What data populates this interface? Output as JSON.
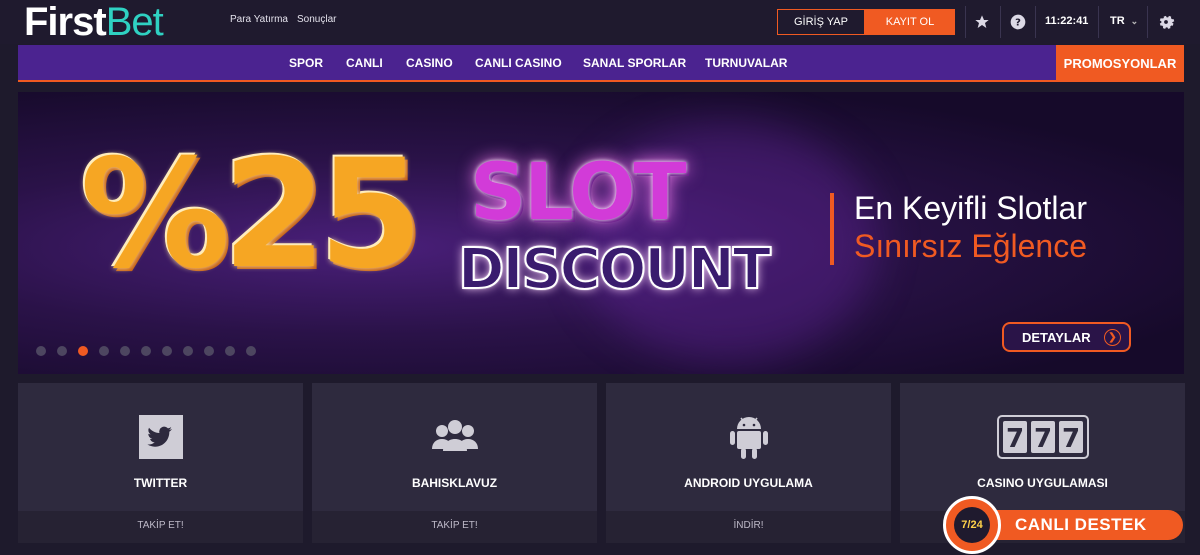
{
  "header": {
    "logo_first": "First",
    "logo_bet": "Bet",
    "links": [
      "Para Yatırma",
      "Sonuçlar"
    ],
    "login_label": "GİRİŞ YAP",
    "register_label": "KAYIT OL",
    "time": "11:22:41",
    "language": "TR",
    "icons": [
      "star-icon",
      "help-icon",
      "gear-icon"
    ]
  },
  "nav": {
    "items": [
      "SPOR",
      "CANLI",
      "CASINO",
      "CANLI CASINO",
      "SANAL SPORLAR",
      "TURNUVALAR"
    ],
    "promo": "PROMOSYONLAR"
  },
  "banner": {
    "percent": "%25",
    "line1": "SLOT",
    "line2": "DISCOUNT",
    "tagline1": "En Keyifli Slotlar",
    "tagline2": "Sınırsız Eğlence",
    "details_label": "DETAYLAR",
    "slide_count": 11,
    "active_slide": 3
  },
  "cards": [
    {
      "title": "TWITTER",
      "action": "TAKİP ET!",
      "icon": "twitter-icon"
    },
    {
      "title": "BAHISKLAVUZ",
      "action": "TAKİP ET!",
      "icon": "group-icon"
    },
    {
      "title": "ANDROID UYGULAMA",
      "action": "İNDİR!",
      "icon": "android-icon"
    },
    {
      "title": "CASINO UYGULAMASI",
      "action": "",
      "icon": "slot-777-icon"
    }
  ],
  "live_support": {
    "badge": "7/24",
    "label": "CANLI DESTEK"
  },
  "colors": {
    "accent": "#f05a22",
    "nav_bg": "#4b2390",
    "page_bg": "#1e1a2c",
    "logo_accent": "#2fd1c2"
  }
}
